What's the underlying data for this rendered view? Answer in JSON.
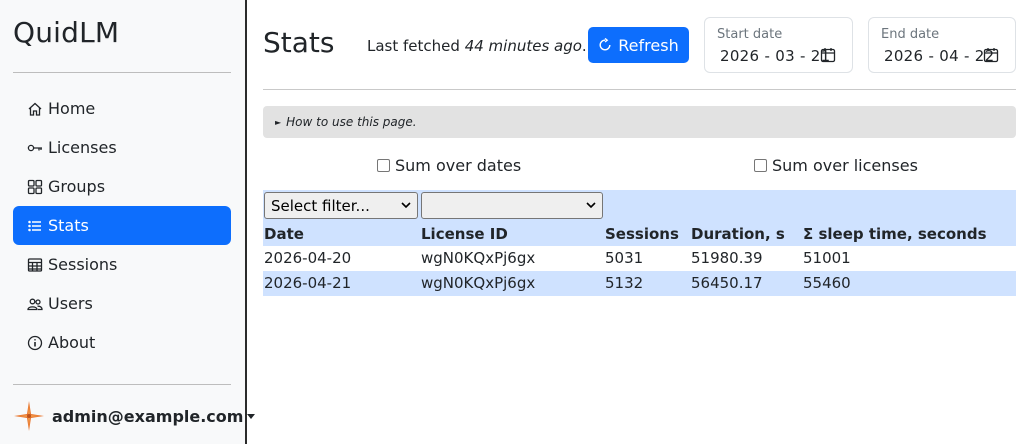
{
  "sidebar": {
    "brand": "QuidLM",
    "items": [
      {
        "label": "Home",
        "icon": "house-icon",
        "active": false
      },
      {
        "label": "Licenses",
        "icon": "key-icon",
        "active": false
      },
      {
        "label": "Groups",
        "icon": "grid-icon",
        "active": false
      },
      {
        "label": "Stats",
        "icon": "list-icon",
        "active": true
      },
      {
        "label": "Sessions",
        "icon": "table-icon",
        "active": false
      },
      {
        "label": "Users",
        "icon": "people-icon",
        "active": false
      },
      {
        "label": "About",
        "icon": "info-icon",
        "active": false
      }
    ],
    "user": "admin@example.com"
  },
  "header": {
    "title": "Stats",
    "fetched_prefix": "Last fetched ",
    "fetched_time": "44 minutes ago",
    "fetched_suffix": ".",
    "refresh_label": "Refresh",
    "start_date_label": "Start date",
    "start_date_value": "2026 - 03 - 21",
    "end_date_label": "End date",
    "end_date_value": "2026 - 04 - 22"
  },
  "howto": "How to use this page.",
  "options": {
    "sum_over_dates": "Sum over dates",
    "sum_over_licenses": "Sum over licenses"
  },
  "table": {
    "filter_placeholder": "Select filter...",
    "filter_value": "",
    "columns": [
      "Date",
      "License ID",
      "Sessions",
      "Duration, s",
      "Σ sleep time, seconds"
    ],
    "rows": [
      [
        "2026-04-20",
        "wgN0KQxPj6gx",
        "5031",
        "51980.39",
        "51001"
      ],
      [
        "2026-04-21",
        "wgN0KQxPj6gx",
        "5132",
        "56450.17",
        "55460"
      ]
    ]
  },
  "colors": {
    "accent": "#0d6efd",
    "table_highlight": "#cfe2ff",
    "sidebar_bg": "#f8f9fa"
  }
}
